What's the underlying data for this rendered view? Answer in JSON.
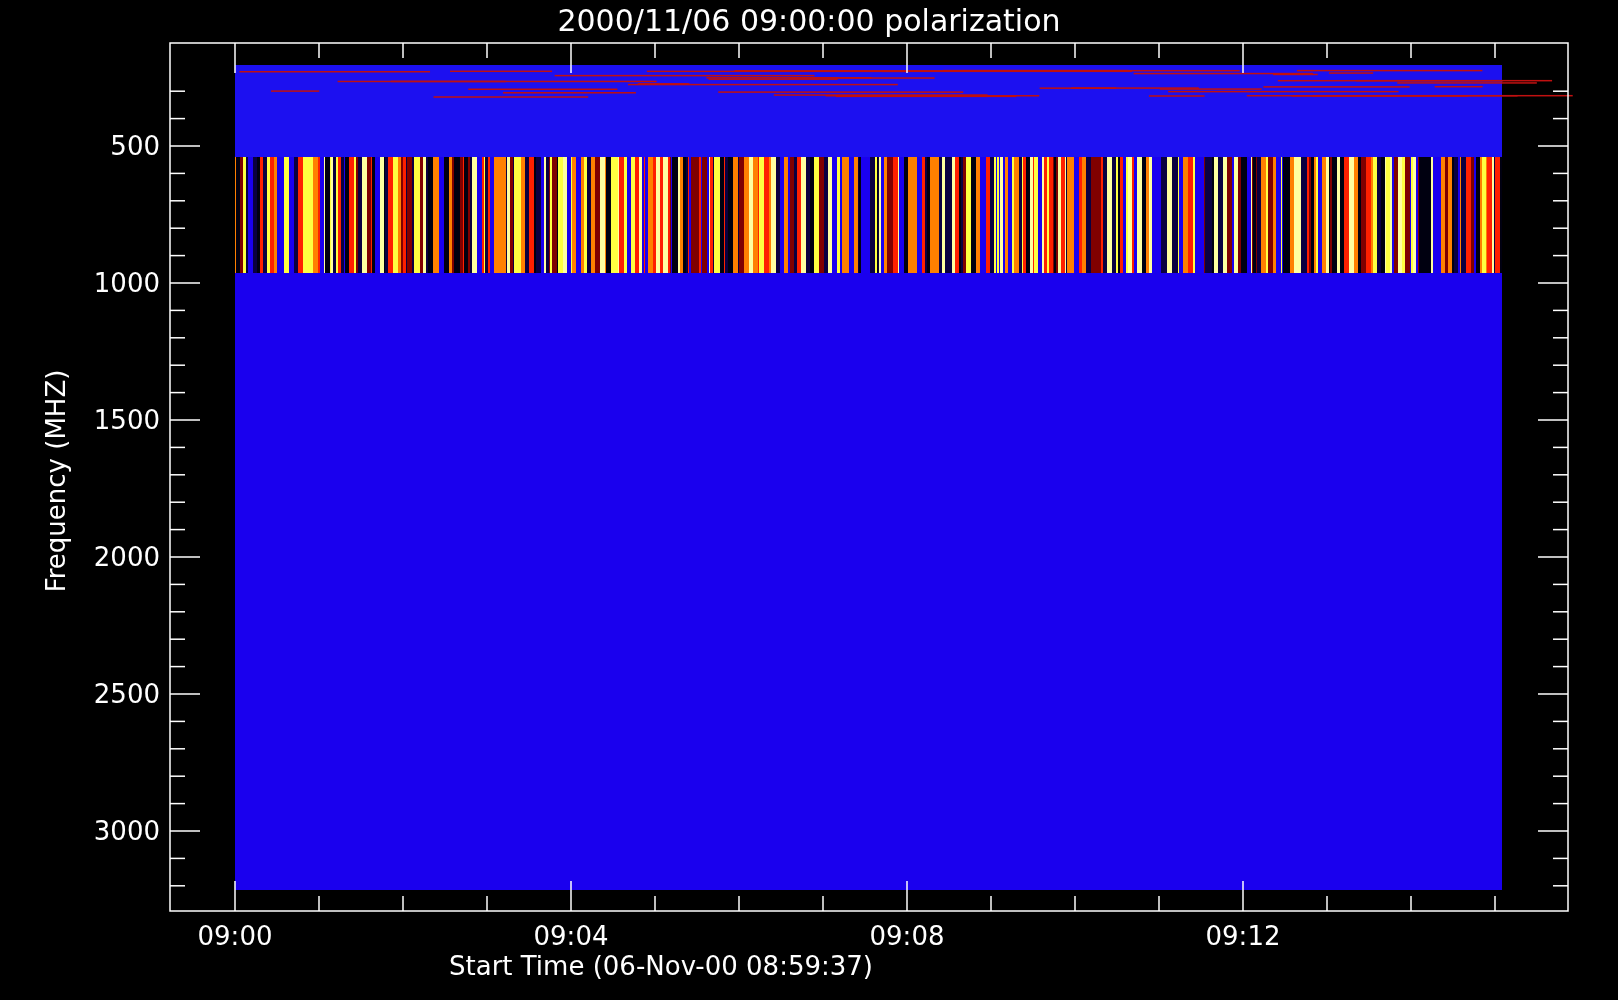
{
  "title": "2000/11/06 09:00:00 polarization",
  "y_axis": {
    "label": "Frequency (MHZ)",
    "ticks": [
      "500",
      "1000",
      "1500",
      "2000",
      "2500",
      "3000"
    ]
  },
  "x_axis": {
    "label": "Start Time (06-Nov-00 08:59:37)",
    "ticks": [
      "09:00",
      "09:04",
      "09:08",
      "09:12"
    ]
  }
}
